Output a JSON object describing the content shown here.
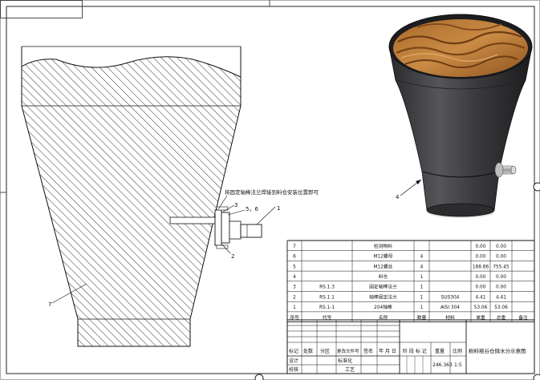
{
  "note": "将固定轴棒法兰焊接到料仓安装位置即可",
  "callouts": {
    "c1": "1",
    "c2": "2",
    "c3": "3",
    "c56": "5，6",
    "c7": "7",
    "c4": "4"
  },
  "bom": {
    "rows": [
      {
        "seq": "7",
        "code": "",
        "name": "检测物料",
        "qty": "",
        "material": "",
        "unit": "0.00",
        "total": "0.00",
        "remark": ""
      },
      {
        "seq": "6",
        "code": "",
        "name": "M12螺母",
        "qty": "4",
        "material": "",
        "unit": "0.00",
        "total": "0.00",
        "remark": ""
      },
      {
        "seq": "5",
        "code": "",
        "name": "M12螺丝",
        "qty": "4",
        "material": "",
        "unit": "188.86",
        "total": "755.45",
        "remark": ""
      },
      {
        "seq": "4",
        "code": "",
        "name": "料仓",
        "qty": "1",
        "material": "",
        "unit": "0.00",
        "total": "0.00",
        "remark": ""
      },
      {
        "seq": "3",
        "code": "RS.1.3",
        "name": "固定轴棒法兰",
        "qty": "1",
        "material": "",
        "unit": "0.00",
        "total": "0.00",
        "remark": ""
      },
      {
        "seq": "2",
        "code": "RS.1.1",
        "name": "轴棒固定法兰",
        "qty": "1",
        "material": "SUS304",
        "unit": "4.41",
        "total": "4.41",
        "remark": ""
      },
      {
        "seq": "1",
        "code": "RS.1-1",
        "name": "204轴棒",
        "qty": "1",
        "material": "AISI 304",
        "unit": "53.06",
        "total": "53.06",
        "remark": ""
      }
    ],
    "headers": {
      "seq": "序号",
      "code": "代号",
      "name": "名称",
      "qty": "数量",
      "material": "材料",
      "unit": "单重",
      "total": "总重",
      "remark": "备注"
    }
  },
  "title_block": {
    "h_mark": "标记",
    "h_count": "处数",
    "h_zone": "分区",
    "h_doc": "更改文件号",
    "h_sign": "签名",
    "h_date": "年 月 日",
    "design": "设计",
    "check": "校核",
    "standardize": "标准化",
    "process": "工艺",
    "stage": "阶 段 标 记",
    "weight_label": "重量",
    "scale_label": "比例",
    "weight": "246.363",
    "scale": "1:5",
    "title": "粉料粮谷仓微水分示意图"
  }
}
